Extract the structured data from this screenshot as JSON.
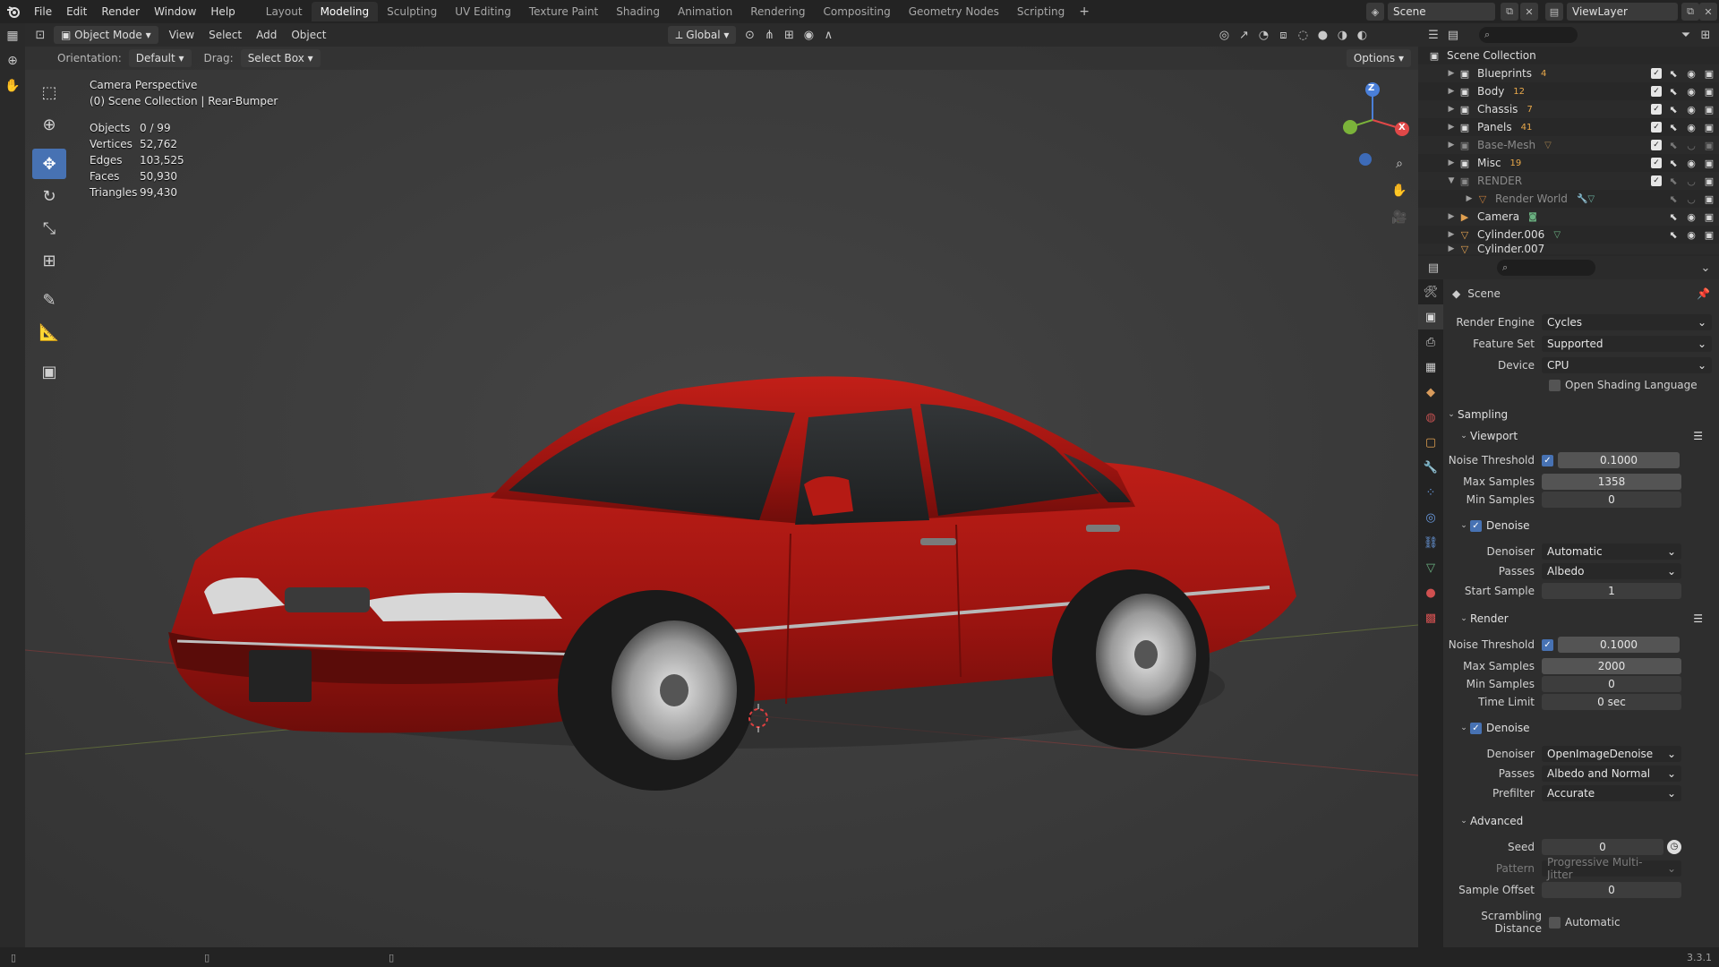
{
  "topbar": {
    "menus": [
      "File",
      "Edit",
      "Render",
      "Window",
      "Help"
    ],
    "workspaces": [
      "Layout",
      "Modeling",
      "Sculpting",
      "UV Editing",
      "Texture Paint",
      "Shading",
      "Animation",
      "Rendering",
      "Compositing",
      "Geometry Nodes",
      "Scripting"
    ],
    "active_workspace": "Modeling",
    "add_tab": "+",
    "scene": "Scene",
    "view_layer": "ViewLayer"
  },
  "viewport": {
    "mode": "Object Mode",
    "menus": [
      "View",
      "Select",
      "Add",
      "Object"
    ],
    "transform_orientation": "Global",
    "orientation_label": "Orientation:",
    "orientation_value": "Default",
    "drag_label": "Drag:",
    "drag_value": "Select Box",
    "options": "Options",
    "info_title": "Camera Perspective",
    "info_subtitle": "(0) Scene Collection | Rear-Bumper",
    "stats": [
      {
        "label": "Objects",
        "value": "0 / 99"
      },
      {
        "label": "Vertices",
        "value": "52,762"
      },
      {
        "label": "Edges",
        "value": "103,525"
      },
      {
        "label": "Faces",
        "value": "50,930"
      },
      {
        "label": "Triangles",
        "value": "99,430"
      }
    ],
    "gizmo": {
      "z": "Z",
      "x": "X"
    }
  },
  "outliner": {
    "root": "Scene Collection",
    "items": [
      {
        "name": "Blueprints",
        "badge": "4",
        "dim": false
      },
      {
        "name": "Body",
        "badge": "12",
        "dim": false
      },
      {
        "name": "Chassis",
        "badge": "7",
        "dim": false
      },
      {
        "name": "Panels",
        "badge": "41",
        "dim": false
      },
      {
        "name": "Base-Mesh",
        "badge": "",
        "dim": true
      },
      {
        "name": "Misc",
        "badge": "19",
        "dim": false
      },
      {
        "name": "RENDER",
        "badge": "",
        "dim": true
      },
      {
        "name": "Render World",
        "badge": "",
        "dim": true
      },
      {
        "name": "Camera",
        "badge": "",
        "dim": false
      },
      {
        "name": "Cylinder.006",
        "badge": "",
        "dim": false
      },
      {
        "name": "Cylinder.007",
        "badge": "",
        "dim": false
      }
    ]
  },
  "properties": {
    "context": "Scene",
    "render_engine_label": "Render Engine",
    "render_engine": "Cycles",
    "feature_set_label": "Feature Set",
    "feature_set": "Supported",
    "device_label": "Device",
    "device": "CPU",
    "osl_label": "Open Shading Language",
    "sampling": "Sampling",
    "viewport_panel": "Viewport",
    "vp_noise_label": "Noise Threshold",
    "vp_noise": "0.1000",
    "vp_max_label": "Max Samples",
    "vp_max": "1358",
    "vp_min_label": "Min Samples",
    "vp_min": "0",
    "vp_denoise": "Denoise",
    "vp_denoiser_label": "Denoiser",
    "vp_denoiser": "Automatic",
    "vp_passes_label": "Passes",
    "vp_passes": "Albedo",
    "vp_start_label": "Start Sample",
    "vp_start": "1",
    "render_panel": "Render",
    "r_noise_label": "Noise Threshold",
    "r_noise": "0.1000",
    "r_max_label": "Max Samples",
    "r_max": "2000",
    "r_min_label": "Min Samples",
    "r_min": "0",
    "r_time_label": "Time Limit",
    "r_time": "0 sec",
    "r_denoise": "Denoise",
    "r_denoiser_label": "Denoiser",
    "r_denoiser": "OpenImageDenoise",
    "r_passes_label": "Passes",
    "r_passes": "Albedo and Normal",
    "r_prefilter_label": "Prefilter",
    "r_prefilter": "Accurate",
    "advanced": "Advanced",
    "seed_label": "Seed",
    "seed": "0",
    "pattern_label": "Pattern",
    "pattern": "Progressive Multi-Jitter",
    "offset_label": "Sample Offset",
    "offset": "0",
    "scramble_label": "Scrambling Distance",
    "scramble_auto": "Automatic"
  },
  "status": {
    "version": "3.3.1"
  },
  "colors": {
    "accent": "#4772b3",
    "car_paint": "#a01212"
  }
}
